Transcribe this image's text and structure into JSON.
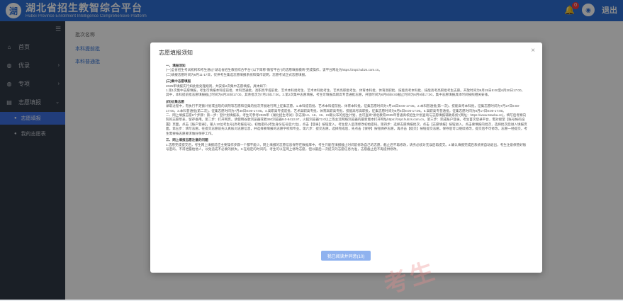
{
  "header": {
    "logo_text": "湖",
    "title": "湖北省招生教智综合平台",
    "subtitle": "Hubei Province Enrollment Intelligence Comprehensive Platform",
    "notification_count": "0",
    "exit_label": "退出",
    "avatar_text": "◉"
  },
  "sidebar": {
    "items": [
      {
        "label": "首页",
        "icon": "home-icon"
      },
      {
        "label": "优录",
        "icon": "user-icon"
      },
      {
        "label": "专项",
        "icon": "user-icon"
      },
      {
        "label": "志愿填报",
        "icon": "form-icon"
      }
    ],
    "subitems": [
      {
        "label": "志愿填报"
      },
      {
        "label": "我的志愿表"
      }
    ]
  },
  "content": {
    "breadcrumb": "批次名称",
    "links": [
      "本科提前批",
      "本科普通批"
    ]
  },
  "dialog": {
    "title": "志愿填报须知",
    "close": "×",
    "paragraphs": [
      {
        "t": "一、填报须知",
        "sec": true
      },
      {
        "t": "(一)全省招生考试机构和考生通过\"湖北省招生教智综合平台\"(以下简称\"教智平台\")的志愿填报模块\"完成操作，该平台网址为https://zspt.hubzs.com.cn。"
      },
      {
        "t": "(二)填报志愿时间为6月11-17日，仅供考生集选志愿填报系统和操作说明，志愿考试正式志愿填报。"
      },
      {
        "t": "(三)集中志愿填报",
        "sec": true
      },
      {
        "t": "2025年填报实行如此批处理规则，共安排2次集中志愿填报，具体如下："
      },
      {
        "t": "1.第1次集中志愿填报，考生可填报本科提前批、本科普通批、高职高专提前批、艺术本科批考生、艺术本科批考生、艺术高职批考生、体育本科批、体育高职批、技能高考本科批、技能高考高职批考生志愿。开放时间为6月25日8:00至6月30日17:00，其中，本科提前批志愿填报截止时间为6月30日17:00，其余批次为7月2日17:00。2.第2次集中志愿填报，考生可填报高职高专普通批志愿，开放时间为6月8日8:00截止时间为6月9日17:00，集中志愿填报具体时间按照相关安排。"
      },
      {
        "t": "(四)征集志愿",
        "sec": true
      },
      {
        "t": "录取过程中，有执行不足额计划或出现的调剂等志愿和征集的批次开展进行网上征集志愿，1.本科提前批、艺术本科提前批、体育本科批，征集志愿时间为7月16日8:00-17:00。2.本科普通批(第一次)，技能高考本科批，征集志愿时间为7月27日8:00-17:00。3.本科普通批(第二次)，征集志愿时间为7月30日8:00-17:00。4.高职高专提前批、艺术高职高专批、体育高职高专批、技能高考高职批，征集志愿时间为8月5日8:00-17:00。5.高职高专普通批，征集志愿时间为8月17日8:00-17:00。"
      },
      {
        "t": "二、网上填报志愿6个步骤：第一步：登计划填报表。考生可参考2025年《湖北招生考试》杂志第13、16、19、22期公布的招生计划，也可查阅\"湖北教育2025年普通高校招生计划查询与志愿填报辅助系统\"(网址：https://www.5taeba.cn)，填写后考察向院的志愿草表，留存备用。第二步：打开网页。请使用谷歌浏览器或者360浏览器9.0-9413.97，火狐浏览器72.0以上等主流网络浏览器的最新版本打开网址https://zspt.hubzs.com.cn。第三步：完成账户登录。考生首次登录平台，需对接至【账号帐码设置】页面，点击【账户登录】，输入10位考生号(高考报名号)，初始密码(考生身份证号后六位)，点击【登录】按钮登入，考生登入后须修改初始密码。第四步：选择志愿填报批次，点击【志愿填报】按钮进入，点击要填报的批次，选择批次后进入填报页面。第五步：填写志愿。在提交志愿前先认真核对志愿信息，并选择要填报的志愿学校和专业。第六步：提交志愿。选择完成后，先点击【保存】按钮保存志愿，再点击【提交】按钮提交志愿。保存后可以继续修改，提交后不可修改。志愿一经提交，考生需要按志愿要求做好保存工作。"
      },
      {
        "t": "三、网上填报志愿注意的问题",
        "sec": true
      },
      {
        "t": "1.志愿完成提交后，考生网上填报前应主要操作步骤一个都不能少。网上填报的志愿信息保存在数据库中，考生只能在填报截止时间前修改自己的志愿，截止后不再修改，请务必核对无误后再提交。2.确认填报完成后系统将自动退出，考生注意保管好账号密码，不得泄露给他人，以免造成不必要的损失。3.在规定的时间内，考生可以在网上修改志愿，但以最后一次提交的志愿信息为准，志愿截止后不再提供修改。"
      }
    ],
    "confirm_button": "我已阅读并同意(10)",
    "watermark": "考生"
  }
}
